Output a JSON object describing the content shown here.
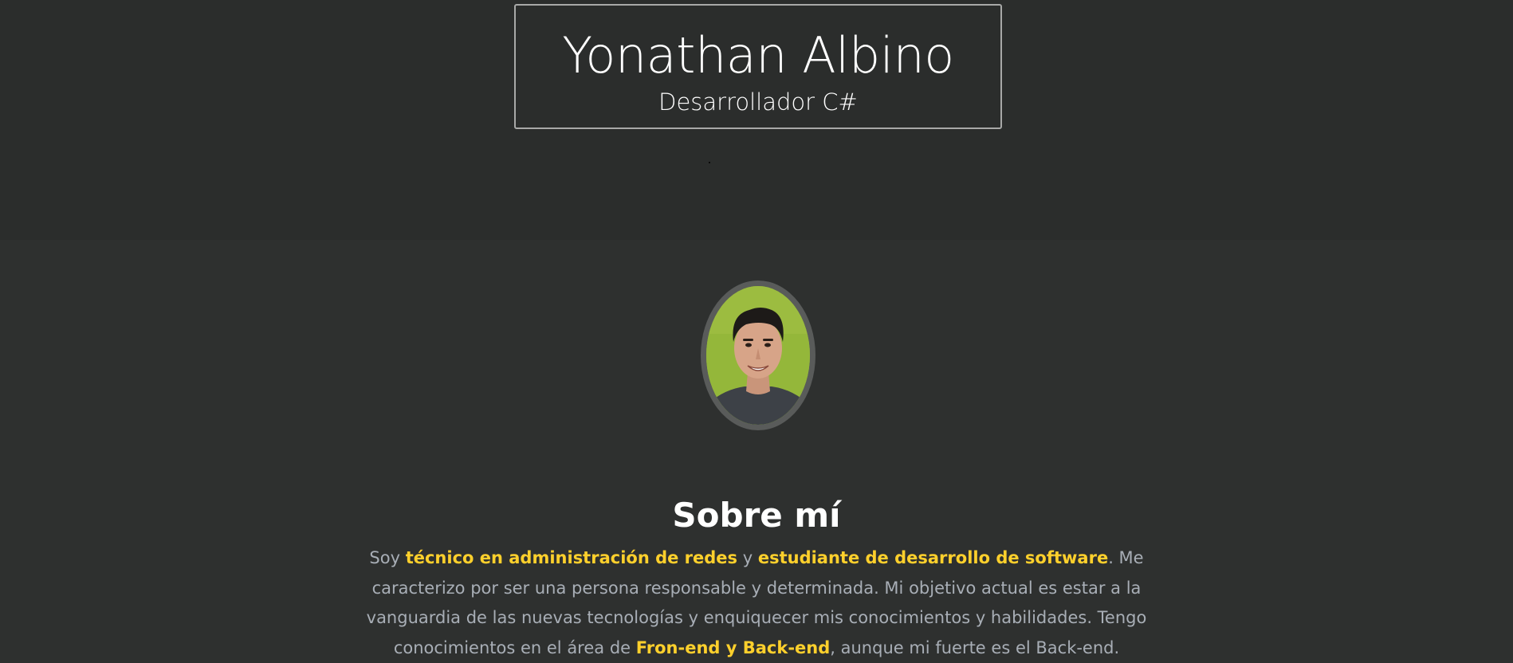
{
  "header": {
    "name": "Yonathan Albino",
    "role": "Desarrollador C#"
  },
  "about": {
    "avatar_alt": "profile photo",
    "title": "Sobre mí",
    "bio": {
      "p1_a": "Soy ",
      "p1_hl1": "técnico en administración de redes",
      "p1_b": " y ",
      "p1_hl2": "estudiante de desarrollo de software",
      "p1_c": ". Me caracterizo por ser una persona responsable y determinada. Mi objetivo actual es estar a la vanguardia de las nuevas tecnologías y enquiquecer mis conocimientos y habilidades. Tengo conocimientos en el área de ",
      "p1_hl3": "Fron-end y Back-end",
      "p1_d": ", aunque mi fuerte es el Back-end."
    }
  },
  "colors": {
    "hero_bg": "#2b2d2c",
    "page_bg": "#2e302f",
    "accent": "#ffd02c",
    "body_text": "#a8aeb6",
    "title_text": "#ffffff"
  }
}
